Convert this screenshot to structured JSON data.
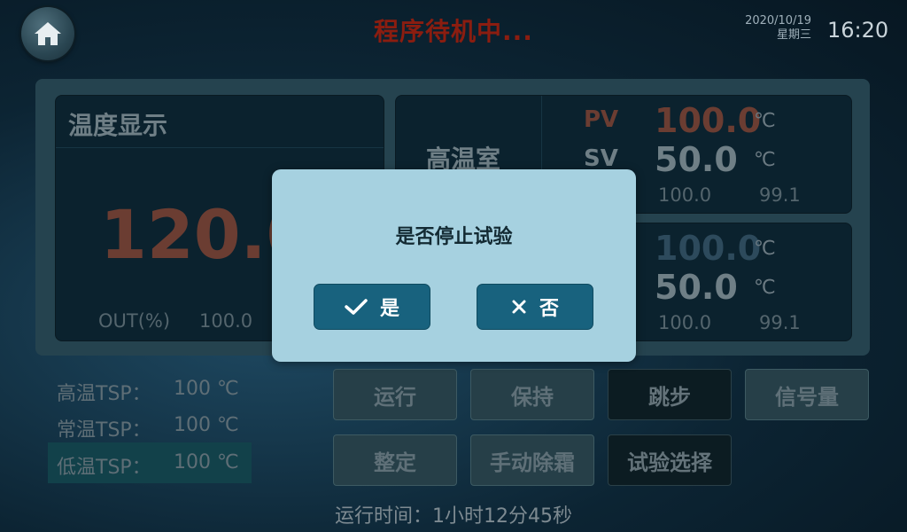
{
  "header": {
    "title": "程序待机中...",
    "date": "2020/10/19",
    "weekday": "星期三",
    "time": "16:20"
  },
  "temperature_display": {
    "title": "温度显示",
    "value": "120.0",
    "out_label": "OUT(%)",
    "out_value": "100.0"
  },
  "zones": [
    {
      "name": "高温室",
      "pv_label": "PV",
      "pv_value": "100.0",
      "sv_label": "SV",
      "sv_value": "50.0",
      "unit": "℃",
      "reading_a": "100.0",
      "reading_b": "99.1"
    },
    {
      "pv_value": "100.0",
      "sv_value": "50.0",
      "unit": "℃",
      "reading_a": "100.0",
      "reading_b": "99.1"
    }
  ],
  "tsp": [
    {
      "label": "高温TSP：",
      "value": "100 ℃"
    },
    {
      "label": "常温TSP：",
      "value": "100 ℃"
    },
    {
      "label": "低温TSP：",
      "value": "100 ℃"
    }
  ],
  "buttons": {
    "run": "运行",
    "hold": "保持",
    "skip": "跳步",
    "signal": "信号量",
    "tune": "整定",
    "defrost": "手动除霜",
    "test_select": "试验选择"
  },
  "runtime": "运行时间：1小时12分45秒",
  "dialog": {
    "message": "是否停止试验",
    "yes": "是",
    "no": "否"
  },
  "icons": {
    "home": "home-icon",
    "yes": "check-icon",
    "no": "close-icon"
  },
  "colors": {
    "title": "#8b1d10",
    "dialog_bg": "#a6d1e0",
    "dialog_button": "#18627e"
  }
}
